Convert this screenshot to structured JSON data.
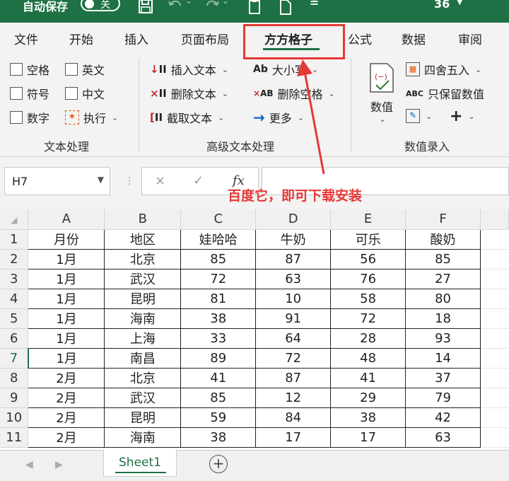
{
  "titlebar": {
    "autosave_label": "自动保存",
    "autosave_state": "关",
    "zoom_fragment": "36"
  },
  "tabs": [
    {
      "label": "文件"
    },
    {
      "label": "开始"
    },
    {
      "label": "插入"
    },
    {
      "label": "页面布局"
    },
    {
      "label": "方方格子",
      "active": true
    },
    {
      "label": "公式"
    },
    {
      "label": "数据"
    },
    {
      "label": "审阅"
    }
  ],
  "ribbon": {
    "text_processing": {
      "checkboxes": [
        "空格",
        "英文",
        "符号",
        "中文",
        "数字"
      ],
      "execute": "执行",
      "group_label": "文本处理"
    },
    "advanced_text": {
      "insert_text": "插入文本",
      "delete_text": "删除文本",
      "extract_text": "截取文本",
      "case": "大小写",
      "delete_space": "删除空格",
      "more": "更多",
      "group_label": "高级文本处理"
    },
    "numeric_entry": {
      "value": "数值",
      "round": "四舍五入",
      "keep_value": "只保留数值",
      "group_label": "数值录入"
    }
  },
  "formula_bar": {
    "name_box": "H7",
    "cancel": "×",
    "confirm": "✓",
    "fx": "fx",
    "formula": ""
  },
  "annotation": {
    "text": "百度它，即可下载安装"
  },
  "sheet": {
    "columns": [
      "A",
      "B",
      "C",
      "D",
      "E",
      "F"
    ],
    "header_row": [
      "月份",
      "地区",
      "娃哈哈",
      "牛奶",
      "可乐",
      "酸奶"
    ],
    "rows": [
      [
        "1月",
        "北京",
        "85",
        "87",
        "56",
        "85"
      ],
      [
        "1月",
        "武汉",
        "72",
        "63",
        "76",
        "27"
      ],
      [
        "1月",
        "昆明",
        "81",
        "10",
        "58",
        "80"
      ],
      [
        "1月",
        "海南",
        "38",
        "91",
        "72",
        "18"
      ],
      [
        "1月",
        "上海",
        "33",
        "64",
        "28",
        "93"
      ],
      [
        "1月",
        "南昌",
        "89",
        "72",
        "48",
        "14"
      ],
      [
        "2月",
        "北京",
        "41",
        "87",
        "41",
        "37"
      ],
      [
        "2月",
        "武汉",
        "85",
        "12",
        "29",
        "79"
      ],
      [
        "2月",
        "昆明",
        "59",
        "84",
        "38",
        "42"
      ],
      [
        "2月",
        "海南",
        "38",
        "17",
        "17",
        "63"
      ]
    ],
    "row_numbers": [
      "1",
      "2",
      "3",
      "4",
      "5",
      "6",
      "7",
      "8",
      "9",
      "10",
      "11"
    ],
    "selected_row": "7"
  },
  "sheet_tabs": [
    {
      "label": "Sheet1",
      "active": true
    }
  ],
  "colors": {
    "excel_green": "#1e7145",
    "annotation_red": "#e53935"
  }
}
